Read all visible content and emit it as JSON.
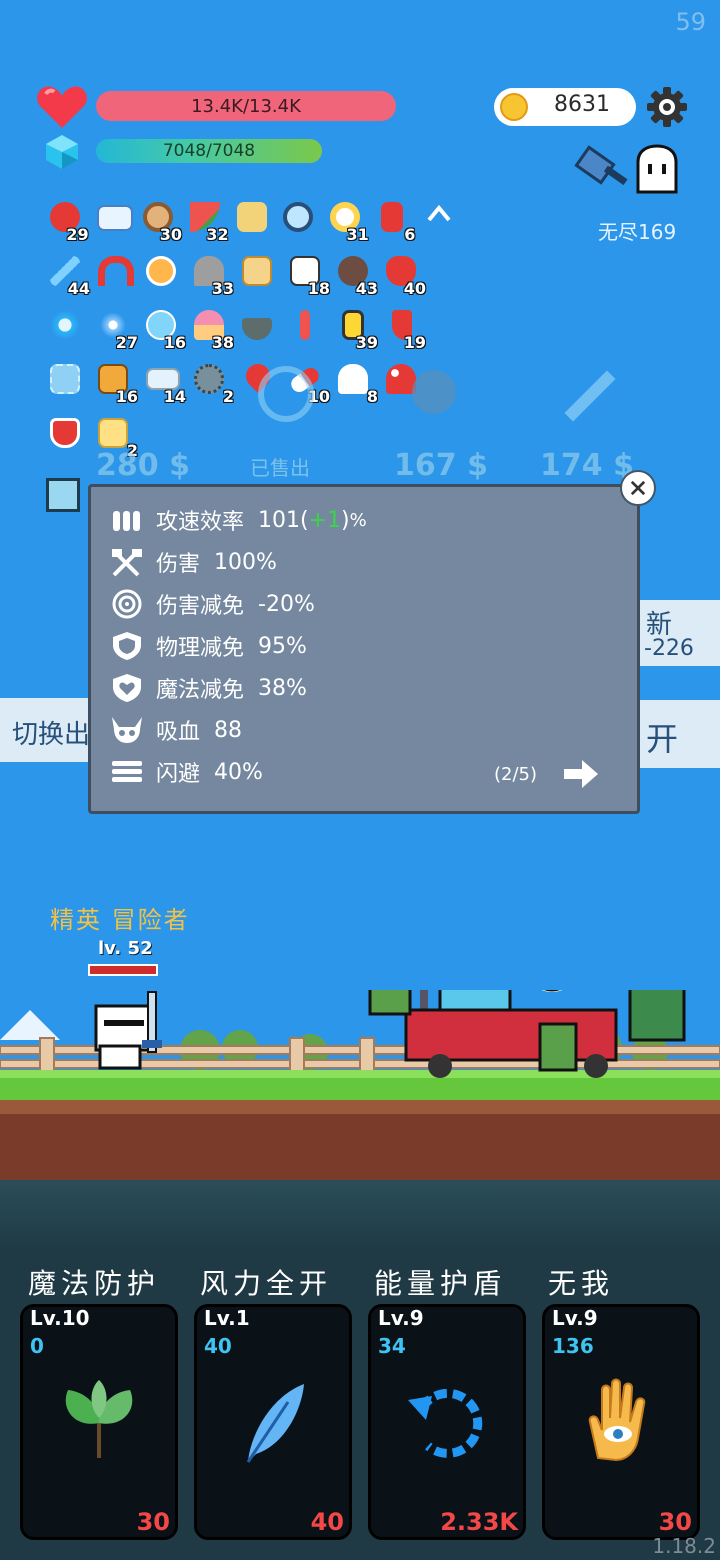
{
  "fps": "59",
  "version": "1.18.2",
  "hud": {
    "hp_text": "13.4K/13.4K",
    "mp_text": "7048/7048",
    "coins": "8631",
    "mode_label": "无尽169"
  },
  "inventory": {
    "rows": [
      [
        {
          "icon": "apple-icon",
          "count": "29"
        },
        {
          "icon": "star-card-icon",
          "count": ""
        },
        {
          "icon": "donut-icon",
          "count": "30"
        },
        {
          "icon": "watermelon-icon",
          "count": "32"
        },
        {
          "icon": "treasure-map-icon",
          "count": ""
        },
        {
          "icon": "magnifier-icon",
          "count": ""
        },
        {
          "icon": "flower-icon",
          "count": "31"
        },
        {
          "icon": "bookmark-icon",
          "count": "6"
        },
        {
          "icon": "chevron-up-icon",
          "count": ""
        }
      ],
      [
        {
          "icon": "feather-sword-icon",
          "count": "44"
        },
        {
          "icon": "magnet-icon",
          "count": ""
        },
        {
          "icon": "potion-icon",
          "count": ""
        },
        {
          "icon": "tombstone-icon",
          "count": "33"
        },
        {
          "icon": "scroll-icon",
          "count": ""
        },
        {
          "icon": "playing-cards-icon",
          "count": "18"
        },
        {
          "icon": "coconut-icon",
          "count": "43"
        },
        {
          "icon": "strawberry-icon",
          "count": "40"
        }
      ],
      [
        {
          "icon": "arrows-cross-icon",
          "count": ""
        },
        {
          "icon": "sparkle-dots-icon",
          "count": "27"
        },
        {
          "icon": "bubble-icon",
          "count": "16"
        },
        {
          "icon": "ice-cream-icon",
          "count": "38"
        },
        {
          "icon": "mortar-icon",
          "count": ""
        },
        {
          "icon": "thermometer-icon",
          "count": ""
        },
        {
          "icon": "battery-icon",
          "count": "39"
        },
        {
          "icon": "sock-icon",
          "count": "19"
        }
      ],
      [
        {
          "icon": "frame-icon",
          "count": ""
        },
        {
          "icon": "book-icon",
          "count": "16"
        },
        {
          "icon": "envelope-icon",
          "count": "14"
        },
        {
          "icon": "mace-icon",
          "count": "2"
        },
        {
          "icon": "map-pin-icon",
          "count": ""
        },
        {
          "icon": "pill-icon",
          "count": "10"
        },
        {
          "icon": "ghost-icon",
          "count": "8"
        },
        {
          "icon": "mushroom-icon",
          "count": ""
        }
      ],
      [
        {
          "icon": "shield-badge-icon",
          "count": ""
        },
        {
          "icon": "note-icon",
          "count": "2"
        }
      ]
    ]
  },
  "shop": {
    "price_1": "280 $",
    "sold_label": "已售出",
    "price_2": "167 $",
    "price_3": "174 $"
  },
  "side": {
    "left_label": "切换出",
    "right_top_a": "新",
    "right_top_b": "-226",
    "right_bottom": "开"
  },
  "stats": {
    "items": [
      {
        "icon": "bullets-icon",
        "name": "攻速效率",
        "value": "101",
        "bonus": "+1",
        "suffix": "%"
      },
      {
        "icon": "crossed-axes-icon",
        "name": "伤害",
        "value": "100%"
      },
      {
        "icon": "target-icon",
        "name": "伤害减免",
        "value": "-20%"
      },
      {
        "icon": "shield-icon",
        "name": "物理减免",
        "value": "95%"
      },
      {
        "icon": "heart-shield-icon",
        "name": "魔法减免",
        "value": "38%"
      },
      {
        "icon": "horned-skull-icon",
        "name": "吸血",
        "value": "88"
      },
      {
        "icon": "dash-lines-icon",
        "name": "闪避",
        "value": "40%"
      }
    ],
    "page": "(2/5)",
    "paren_open": "(",
    "paren_close": ")"
  },
  "enemy": {
    "title": "精英 冒险者",
    "level": "lv. 52"
  },
  "skills": [
    {
      "title": "魔法防护",
      "level": "Lv.10",
      "sub": "0",
      "cost": "30",
      "icon": "leaf-icon"
    },
    {
      "title": "风力全开",
      "level": "Lv.1",
      "sub": "40",
      "cost": "40",
      "icon": "feather-icon"
    },
    {
      "title": "能量护盾",
      "level": "Lv.9",
      "sub": "34",
      "cost": "2.33K",
      "icon": "refresh-icon"
    },
    {
      "title": "无我",
      "level": "Lv.9",
      "sub": "136",
      "cost": "30",
      "icon": "eye-hand-icon"
    }
  ]
}
